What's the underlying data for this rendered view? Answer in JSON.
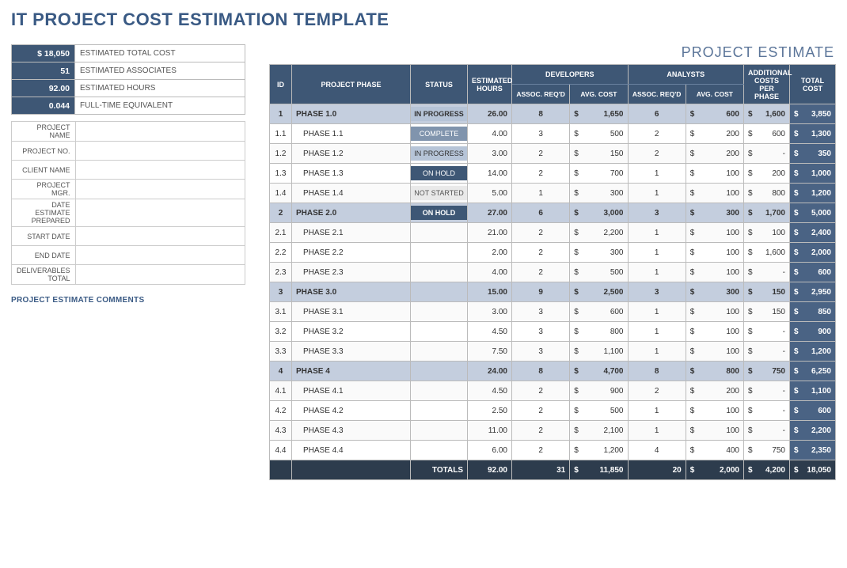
{
  "title": "IT PROJECT COST ESTIMATION TEMPLATE",
  "subtitle": "PROJECT ESTIMATE",
  "summary": [
    {
      "value": "$     18,050",
      "label": "ESTIMATED TOTAL COST"
    },
    {
      "value": "51",
      "label": "ESTIMATED ASSOCIATES"
    },
    {
      "value": "92.00",
      "label": "ESTIMATED HOURS"
    },
    {
      "value": "0.044",
      "label": "FULL-TIME EQUIVALENT"
    }
  ],
  "info_fields": [
    "PROJECT NAME",
    "PROJECT NO.",
    "CLIENT NAME",
    "PROJECT MGR.",
    "DATE ESTIMATE PREPARED",
    "START DATE",
    "END DATE",
    "DELIVERABLES TOTAL"
  ],
  "comments_label": "PROJECT ESTIMATE COMMENTS",
  "headers": {
    "id": "ID",
    "phase": "PROJECT PHASE",
    "status": "STATUS",
    "hours": "ESTIMATED HOURS",
    "dev": "DEVELOPERS",
    "ana": "ANALYSTS",
    "assoc": "ASSOC. REQ'D",
    "avg": "AVG. COST",
    "addl": "ADDITIONAL COSTS PER PHASE",
    "total": "TOTAL COST",
    "totals": "TOTALS"
  },
  "statuses": {
    "IN PROGRESS": "st-inprogress",
    "COMPLETE": "st-complete",
    "ON HOLD": "st-onhold",
    "NOT STARTED": "st-notstarted"
  },
  "rows": [
    {
      "parent": true,
      "id": "1",
      "phase": "PHASE 1.0",
      "status": "IN PROGRESS",
      "hours": "26.00",
      "dev_assoc": "8",
      "dev_cost": "1,650",
      "ana_assoc": "6",
      "ana_cost": "600",
      "addl": "1,600",
      "total": "3,850"
    },
    {
      "parent": false,
      "id": "1.1",
      "phase": "PHASE 1.1",
      "status": "COMPLETE",
      "hours": "4.00",
      "dev_assoc": "3",
      "dev_cost": "500",
      "ana_assoc": "2",
      "ana_cost": "200",
      "addl": "600",
      "total": "1,300"
    },
    {
      "parent": false,
      "id": "1.2",
      "phase": "PHASE 1.2",
      "status": "IN PROGRESS",
      "hours": "3.00",
      "dev_assoc": "2",
      "dev_cost": "150",
      "ana_assoc": "2",
      "ana_cost": "200",
      "addl": "-",
      "total": "350"
    },
    {
      "parent": false,
      "id": "1.3",
      "phase": "PHASE 1.3",
      "status": "ON HOLD",
      "hours": "14.00",
      "dev_assoc": "2",
      "dev_cost": "700",
      "ana_assoc": "1",
      "ana_cost": "100",
      "addl": "200",
      "total": "1,000"
    },
    {
      "parent": false,
      "id": "1.4",
      "phase": "PHASE 1.4",
      "status": "NOT STARTED",
      "hours": "5.00",
      "dev_assoc": "1",
      "dev_cost": "300",
      "ana_assoc": "1",
      "ana_cost": "100",
      "addl": "800",
      "total": "1,200"
    },
    {
      "parent": true,
      "id": "2",
      "phase": "PHASE 2.0",
      "status": "ON HOLD",
      "hours": "27.00",
      "dev_assoc": "6",
      "dev_cost": "3,000",
      "ana_assoc": "3",
      "ana_cost": "300",
      "addl": "1,700",
      "total": "5,000"
    },
    {
      "parent": false,
      "id": "2.1",
      "phase": "PHASE 2.1",
      "status": "",
      "hours": "21.00",
      "dev_assoc": "2",
      "dev_cost": "2,200",
      "ana_assoc": "1",
      "ana_cost": "100",
      "addl": "100",
      "total": "2,400"
    },
    {
      "parent": false,
      "id": "2.2",
      "phase": "PHASE 2.2",
      "status": "",
      "hours": "2.00",
      "dev_assoc": "2",
      "dev_cost": "300",
      "ana_assoc": "1",
      "ana_cost": "100",
      "addl": "1,600",
      "total": "2,000"
    },
    {
      "parent": false,
      "id": "2.3",
      "phase": "PHASE 2.3",
      "status": "",
      "hours": "4.00",
      "dev_assoc": "2",
      "dev_cost": "500",
      "ana_assoc": "1",
      "ana_cost": "100",
      "addl": "-",
      "total": "600"
    },
    {
      "parent": true,
      "id": "3",
      "phase": "PHASE 3.0",
      "status": "",
      "hours": "15.00",
      "dev_assoc": "9",
      "dev_cost": "2,500",
      "ana_assoc": "3",
      "ana_cost": "300",
      "addl": "150",
      "total": "2,950"
    },
    {
      "parent": false,
      "id": "3.1",
      "phase": "PHASE 3.1",
      "status": "",
      "hours": "3.00",
      "dev_assoc": "3",
      "dev_cost": "600",
      "ana_assoc": "1",
      "ana_cost": "100",
      "addl": "150",
      "total": "850"
    },
    {
      "parent": false,
      "id": "3.2",
      "phase": "PHASE 3.2",
      "status": "",
      "hours": "4.50",
      "dev_assoc": "3",
      "dev_cost": "800",
      "ana_assoc": "1",
      "ana_cost": "100",
      "addl": "-",
      "total": "900"
    },
    {
      "parent": false,
      "id": "3.3",
      "phase": "PHASE 3.3",
      "status": "",
      "hours": "7.50",
      "dev_assoc": "3",
      "dev_cost": "1,100",
      "ana_assoc": "1",
      "ana_cost": "100",
      "addl": "-",
      "total": "1,200"
    },
    {
      "parent": true,
      "id": "4",
      "phase": "PHASE 4",
      "status": "",
      "hours": "24.00",
      "dev_assoc": "8",
      "dev_cost": "4,700",
      "ana_assoc": "8",
      "ana_cost": "800",
      "addl": "750",
      "total": "6,250"
    },
    {
      "parent": false,
      "id": "4.1",
      "phase": "PHASE 4.1",
      "status": "",
      "hours": "4.50",
      "dev_assoc": "2",
      "dev_cost": "900",
      "ana_assoc": "2",
      "ana_cost": "200",
      "addl": "-",
      "total": "1,100"
    },
    {
      "parent": false,
      "id": "4.2",
      "phase": "PHASE 4.2",
      "status": "",
      "hours": "2.50",
      "dev_assoc": "2",
      "dev_cost": "500",
      "ana_assoc": "1",
      "ana_cost": "100",
      "addl": "-",
      "total": "600"
    },
    {
      "parent": false,
      "id": "4.3",
      "phase": "PHASE 4.3",
      "status": "",
      "hours": "11.00",
      "dev_assoc": "2",
      "dev_cost": "2,100",
      "ana_assoc": "1",
      "ana_cost": "100",
      "addl": "-",
      "total": "2,200"
    },
    {
      "parent": false,
      "id": "4.4",
      "phase": "PHASE 4.4",
      "status": "",
      "hours": "6.00",
      "dev_assoc": "2",
      "dev_cost": "1,200",
      "ana_assoc": "4",
      "ana_cost": "400",
      "addl": "750",
      "total": "2,350"
    }
  ],
  "totals": {
    "hours": "92.00",
    "dev_assoc": "31",
    "dev_cost": "11,850",
    "ana_assoc": "20",
    "ana_cost": "2,000",
    "addl": "4,200",
    "total": "18,050"
  }
}
